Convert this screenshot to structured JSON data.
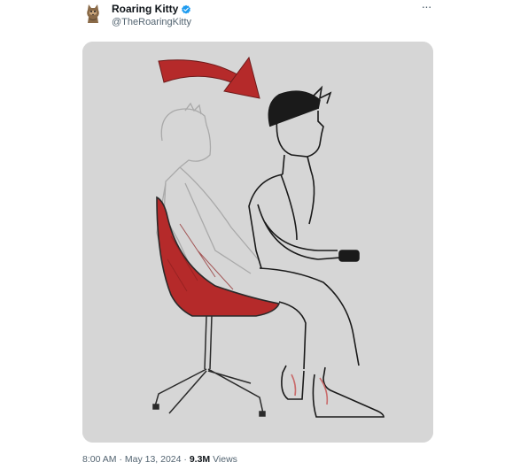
{
  "tweet": {
    "author_name": "Roaring Kitty",
    "author_handle": "@TheRoaringKitty",
    "verified_icon": "verified-badge-icon",
    "more_icon": "more-horizontal-icon",
    "more_label": "···",
    "timestamp": "8:00 AM · May 13, 2024",
    "separator": " · ",
    "views_count": "9.3M",
    "views_label": " Views"
  },
  "colors": {
    "verified": "#1d9bf0",
    "chair": "#b52a2a",
    "arrow": "#b52a2a",
    "media_bg": "#d6d6d6"
  }
}
